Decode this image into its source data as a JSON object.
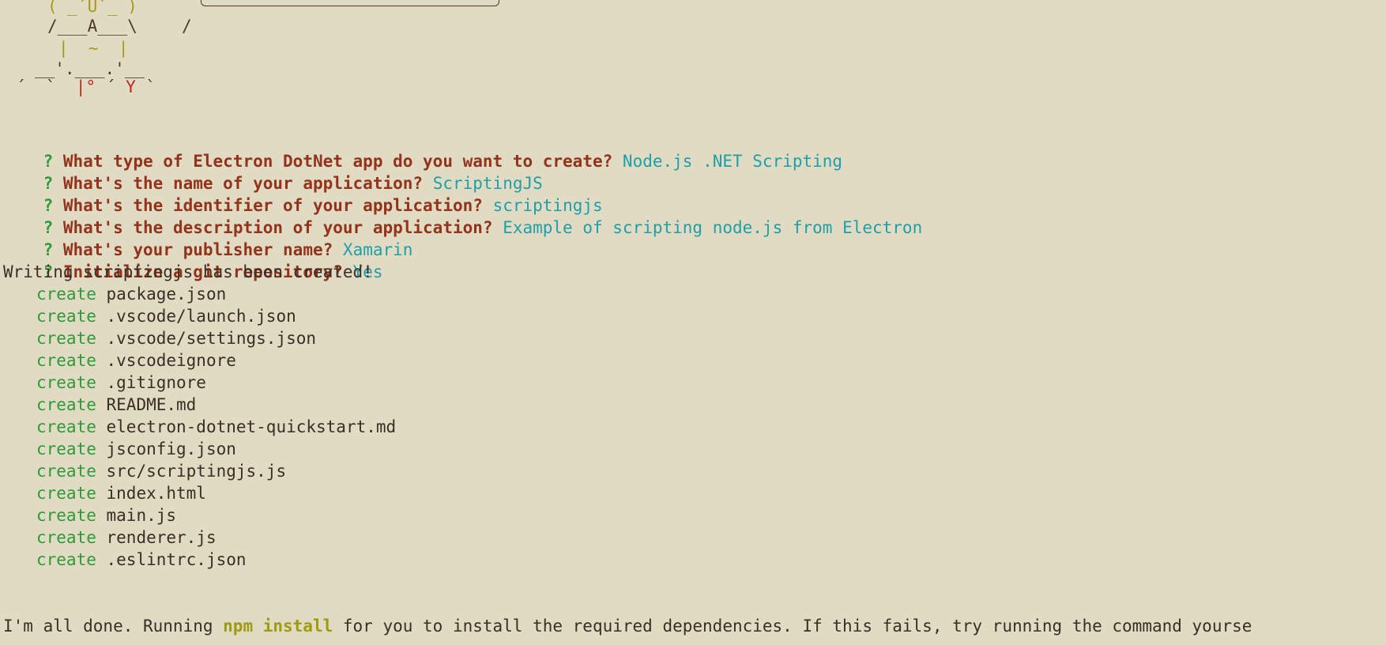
{
  "ascii_art": {
    "row1": "( _´U`_ )",
    "row2_left": "/___A___\\",
    "row2_right": "/",
    "row3": "|  ~  |",
    "row4": "__'.___.'__",
    "row5_a": "´  `  ",
    "row5_b": "|°",
    "row5_c": " ´ ",
    "row5_y": "Y",
    "row5_d": " `"
  },
  "prompts": [
    {
      "mark": "?",
      "question": "What type of Electron DotNet app do you want to create?",
      "answer": "Node.js .NET Scripting"
    },
    {
      "mark": "?",
      "question": "What's the name of your application?",
      "answer": "ScriptingJS"
    },
    {
      "mark": "?",
      "question": "What's the identifier of your application?",
      "answer": "scriptingjs"
    },
    {
      "mark": "?",
      "question": "What's the description of your application?",
      "answer": "Example of scripting node.js from Electron"
    },
    {
      "mark": "?",
      "question": "What's your publisher name?",
      "answer": "Xamarin"
    },
    {
      "mark": "?",
      "question": "Initialize a git repository?",
      "answer": "Yes"
    }
  ],
  "writing_line": "Writing scriptingjs has been created!",
  "create_label": "create",
  "files": [
    "package.json",
    ".vscode/launch.json",
    ".vscode/settings.json",
    ".vscodeignore",
    ".gitignore",
    "README.md",
    "electron-dotnet-quickstart.md",
    "jsconfig.json",
    "src/scriptingjs.js",
    "index.html",
    "main.js",
    "renderer.js",
    ".eslintrc.json"
  ],
  "final_line": {
    "before": "I'm all done. Running ",
    "command": "npm install",
    "after": " for you to install the required dependencies. If this fails, try running the command yourse"
  },
  "colors": {
    "background": "#e0dbc2",
    "question": "#93331c",
    "answer": "#1f9faa",
    "create": "#2e9a3a",
    "command": "#9f9b10"
  }
}
